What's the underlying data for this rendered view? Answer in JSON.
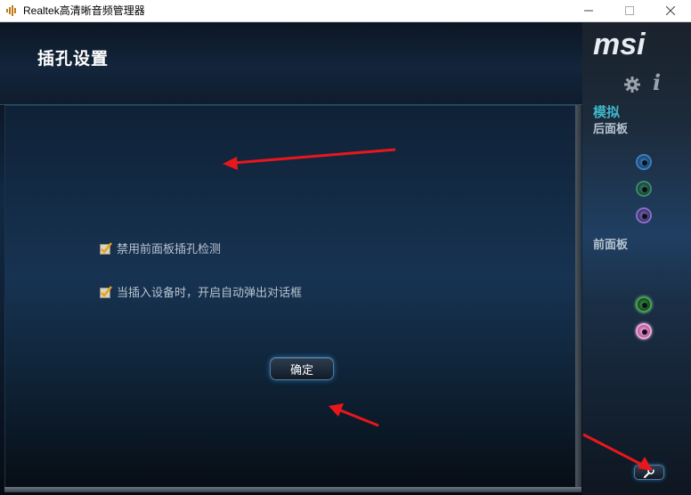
{
  "window": {
    "title": "Realtek高清晰音频管理器"
  },
  "header": {
    "title": "插孔设置"
  },
  "options": [
    {
      "label": "禁用前面板插孔检测",
      "checked": true
    },
    {
      "label": "当插入设备时，开启自动弹出对话框",
      "checked": true
    }
  ],
  "buttons": {
    "ok_label": "确定"
  },
  "sidebar": {
    "logo_text": "msi",
    "info_glyph": "i",
    "analog_label": "模拟",
    "rear_panel_label": "后面板",
    "front_panel_label": "前面板",
    "rear_jacks": [
      "blue",
      "green",
      "purple"
    ],
    "front_jacks": [
      "green",
      "pink"
    ]
  },
  "colors": {
    "accent_teal": "#3fb6c8",
    "annotation_arrow": "#e8171c",
    "checkbox_check": "#e8a21a"
  },
  "icons": [
    "app-speaker-icon",
    "minimize-icon",
    "maximize-icon",
    "close-icon",
    "gear-icon",
    "info-icon",
    "wrench-icon",
    "checkbox-checked-icon",
    "annotation-arrow"
  ]
}
